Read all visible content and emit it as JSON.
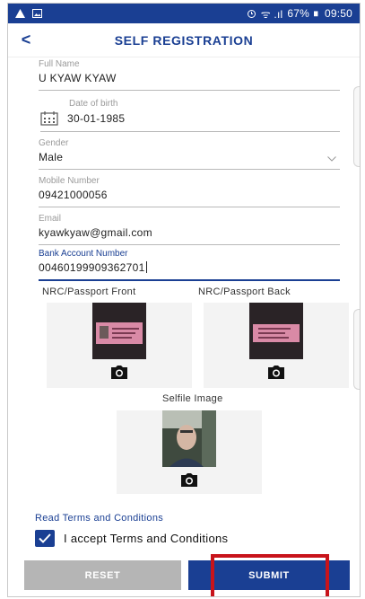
{
  "status_bar": {
    "battery": "67%",
    "time": "09:50",
    "signal_text": "ᯤ .ıl"
  },
  "header": {
    "back_symbol": "<",
    "title": "SELF REGISTRATION"
  },
  "form": {
    "full_name": {
      "label": "Full Name",
      "value": "U KYAW KYAW"
    },
    "date_of_birth": {
      "label": "Date of birth",
      "value": "30-01-1985"
    },
    "gender": {
      "label": "Gender",
      "value": "Male"
    },
    "mobile": {
      "label": "Mobile Number",
      "value": "09421000056"
    },
    "email": {
      "label": "Email",
      "value": "kyawkyaw@gmail.com"
    },
    "bank_account": {
      "label": "Bank Account Number",
      "value": "00460199909362701"
    }
  },
  "images": {
    "nrc_front_label": "NRC/Passport Front",
    "nrc_back_label": "NRC/Passport Back",
    "selfie_label": "Selfile Image"
  },
  "terms": {
    "link_text": "Read Terms and Conditions",
    "accept_text": "I accept Terms and Conditions",
    "accepted": true
  },
  "buttons": {
    "reset": "RESET",
    "submit": "SUBMIT"
  },
  "colors": {
    "primary": "#1a3f93",
    "reset_button": "#b5b5b5",
    "highlight": "#c8141b"
  }
}
